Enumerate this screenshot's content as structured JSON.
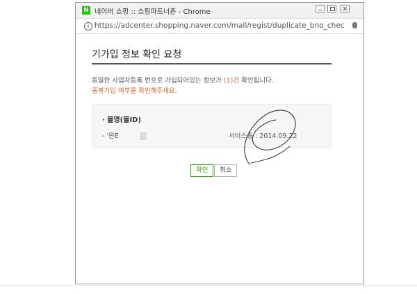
{
  "window": {
    "title": "네이버 쇼핑 :: 쇼핑파트너존 - Chrome",
    "app_icon": "N",
    "url": "https://adcenter.shopping.naver.com/mall/regist/duplicate_bno_check_popu..."
  },
  "page": {
    "title": "기가입 정보 확인 요청",
    "message_prefix": "동일한 사업자등록 번호로 가입되어있는 정보가 ",
    "message_count": "(1)건",
    "message_suffix": " 확인됩니다.",
    "message_notice": "중복가입 여부를 확인해주세요.",
    "section_heading": "· 몰명(몰ID)",
    "mall_name": "- '윈E",
    "service_start": "서비스중 : 2014.09.22"
  },
  "buttons": {
    "confirm": "확인",
    "cancel": "취소"
  },
  "colors": {
    "accent_orange": "#e8632b",
    "confirm_green": "#2db400"
  },
  "icons": [
    "naver-app-icon",
    "info-icon",
    "key-icon"
  ]
}
